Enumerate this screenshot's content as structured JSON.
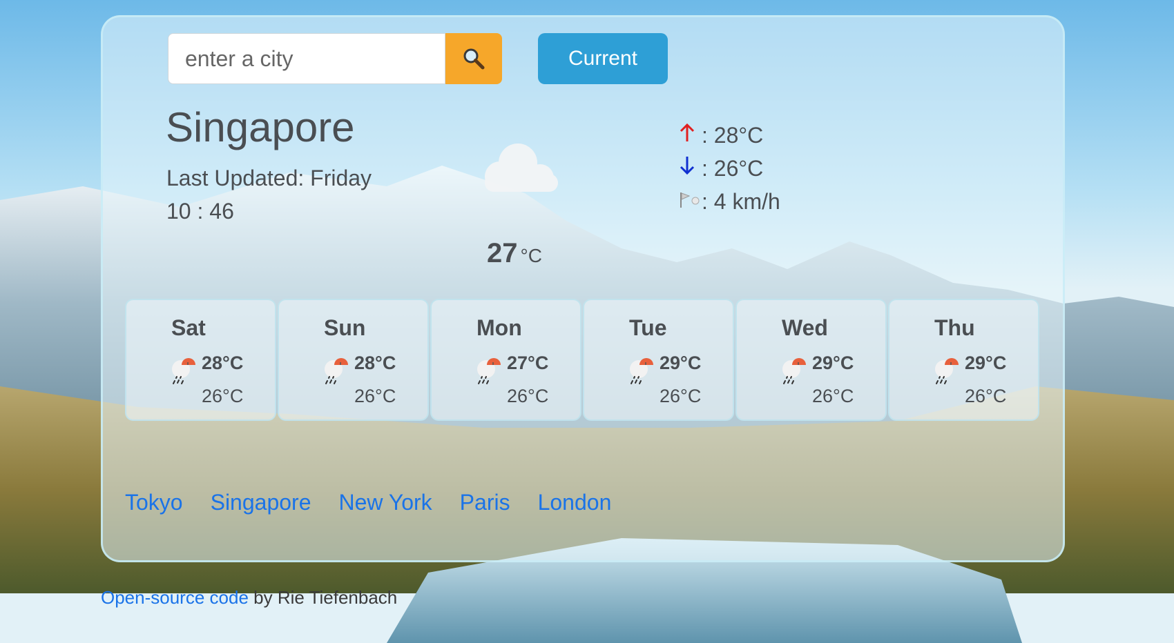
{
  "search": {
    "placeholder": "enter a city",
    "icon": "magnifier-icon"
  },
  "current_button": {
    "label": "Current"
  },
  "city": {
    "name": "Singapore"
  },
  "updated": {
    "line1": "Last Updated: Friday",
    "time": "10 : 46"
  },
  "current": {
    "temp": "27",
    "unit": "°C",
    "icon": "cloud-icon"
  },
  "stats": {
    "max": ": 28°C",
    "min": ": 26°C",
    "wind": ": 4 km/h"
  },
  "forecast": [
    {
      "day": "Sat",
      "high": "28°C",
      "low": "26°C",
      "icon": "rain-icon"
    },
    {
      "day": "Sun",
      "high": "28°C",
      "low": "26°C",
      "icon": "rain-icon"
    },
    {
      "day": "Mon",
      "high": "27°C",
      "low": "26°C",
      "icon": "rain-icon"
    },
    {
      "day": "Tue",
      "high": "29°C",
      "low": "26°C",
      "icon": "rain-icon"
    },
    {
      "day": "Wed",
      "high": "29°C",
      "low": "26°C",
      "icon": "rain-icon"
    },
    {
      "day": "Thu",
      "high": "29°C",
      "low": "26°C",
      "icon": "rain-icon"
    }
  ],
  "city_links": [
    "Tokyo",
    "Singapore",
    "New York",
    "Paris",
    "London"
  ],
  "footer": {
    "link_text": "Open-source code",
    "text": " by Rie Tiefenbach"
  },
  "colors": {
    "search_button": "#f6a72a",
    "current_button": "#2e9fd6",
    "link": "#1a73e8",
    "arrow_up": "#e02020",
    "arrow_down": "#1030d0"
  }
}
